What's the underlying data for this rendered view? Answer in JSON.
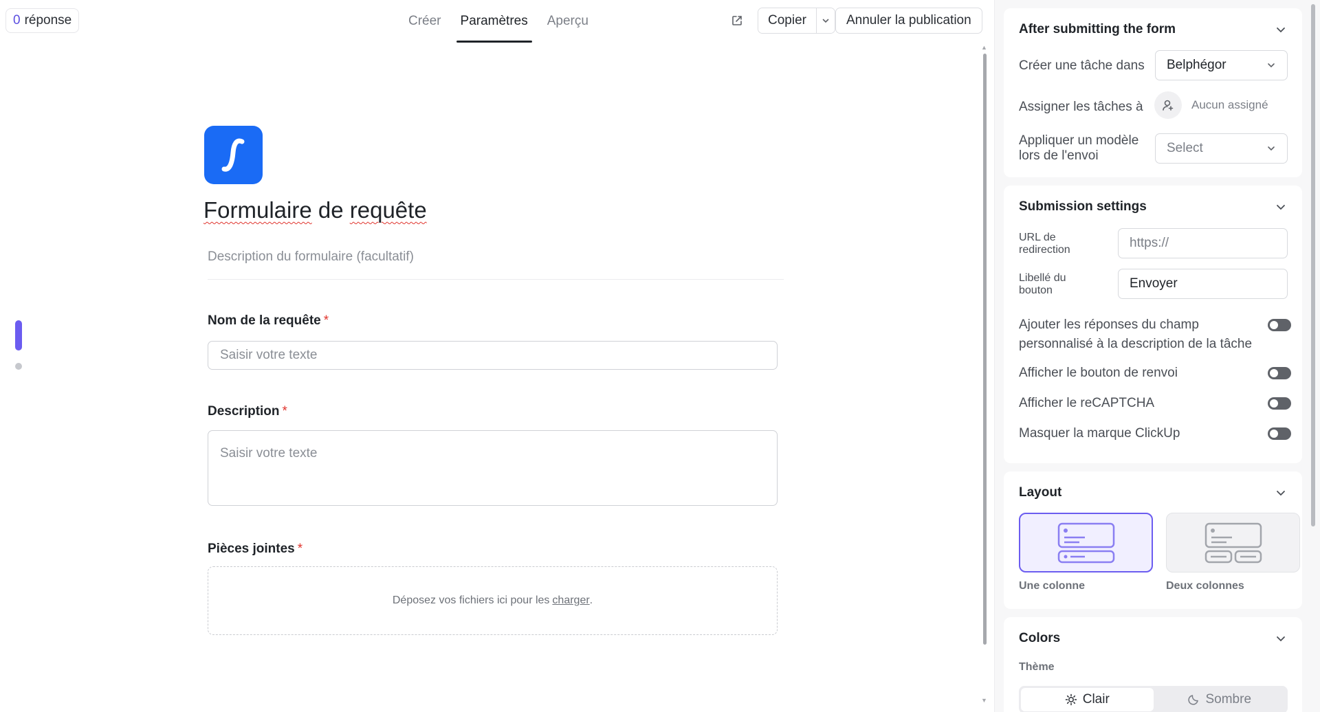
{
  "header": {
    "responses_count": "0",
    "responses_label": "réponse",
    "tabs": [
      {
        "label": "Créer",
        "active": false
      },
      {
        "label": "Paramètres",
        "active": true
      },
      {
        "label": "Aperçu",
        "active": false
      }
    ],
    "copy_label": "Copier",
    "unpublish_label": "Annuler la publication"
  },
  "form": {
    "title_part1": "Formulaire",
    "title_part2": " de ",
    "title_part3": "requête",
    "description_placeholder": "Description du formulaire (facultatif)",
    "fields": [
      {
        "label": "Nom de la requête",
        "required_mark": "*",
        "placeholder": "Saisir votre texte"
      },
      {
        "label": "Description",
        "required_mark": "*",
        "placeholder": "Saisir votre texte"
      },
      {
        "label": "Pièces jointes",
        "required_mark": "*",
        "drop_text": "Déposez vos fichiers ici pour les",
        "drop_link": "charger",
        "drop_suffix": "."
      }
    ]
  },
  "panel": {
    "after_submit": {
      "title": "After submitting the form",
      "create_task_label": "Créer une tâche dans",
      "create_task_value": "Belphégor",
      "assign_label": "Assigner les tâches à",
      "assign_value": "Aucun assigné",
      "template_label_line1": "Appliquer un modèle",
      "template_label_line2": "lors de l'envoi",
      "template_value": "Select"
    },
    "submission": {
      "title": "Submission settings",
      "redirect_label_line1": "URL de",
      "redirect_label_line2": "redirection",
      "redirect_placeholder": "https://",
      "button_label_line1": "Libellé du",
      "button_label_line2": "bouton",
      "button_value": "Envoyer",
      "toggles": [
        {
          "label_line1": "Ajouter les réponses du champ",
          "label_line2": "personnalisé à la description de la tâche",
          "on": false
        },
        {
          "label_line1": "Afficher le bouton de renvoi",
          "label_line2": "",
          "on": false
        },
        {
          "label_line1": "Afficher le reCAPTCHA",
          "label_line2": "",
          "on": false
        },
        {
          "label_line1": "Masquer la marque ClickUp",
          "label_line2": "",
          "on": false
        }
      ]
    },
    "layout": {
      "title": "Layout",
      "options": [
        {
          "label": "Une colonne",
          "selected": true
        },
        {
          "label": "Deux colonnes",
          "selected": false
        }
      ]
    },
    "colors": {
      "title": "Colors",
      "theme_label": "Thème",
      "theme_options": [
        {
          "label": "Clair",
          "active": true
        },
        {
          "label": "Sombre",
          "active": false
        }
      ]
    }
  },
  "colors": {
    "accent": "#6b5cf0",
    "logo_blue": "#1a6bf5",
    "required_red": "#e0342d"
  },
  "icons": {
    "external_link": "external-link-icon",
    "chevron": "chevron-down-icon",
    "user_add": "user-add-icon",
    "sun": "sun-icon",
    "moon": "moon-icon"
  }
}
